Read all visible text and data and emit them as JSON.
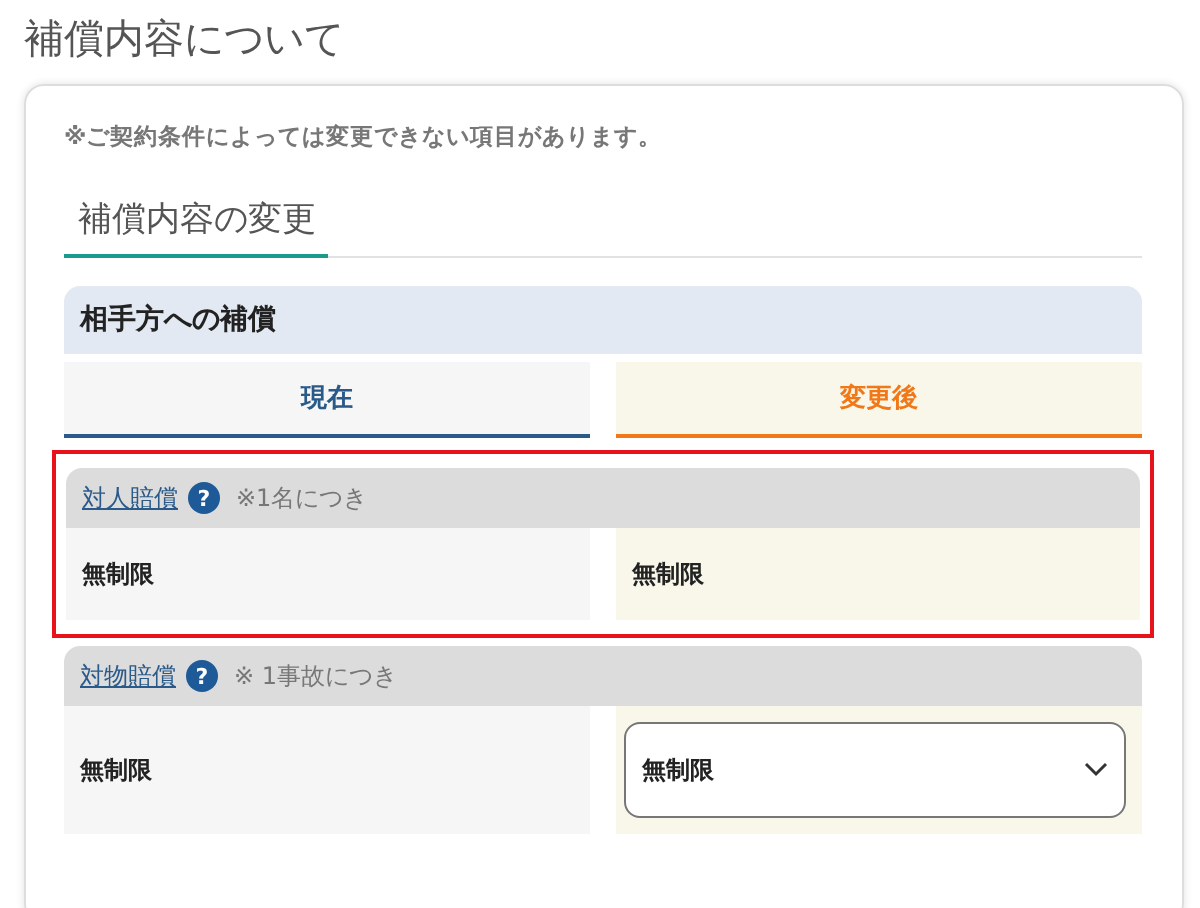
{
  "page_title": "補償内容について",
  "note": "※ご契約条件によっては変更できない項目があります。",
  "section_tab": {
    "label": "補償内容の変更"
  },
  "group": {
    "title": "相手方への補償",
    "columns": [
      {
        "label": "現在",
        "kind": "current"
      },
      {
        "label": "変更後",
        "kind": "changed"
      }
    ],
    "items": [
      {
        "label": "対人賠償",
        "help": "?",
        "condition": "※1名につき",
        "highlighted": true,
        "current": "無制限",
        "changed": {
          "kind": "text",
          "value": "無制限"
        }
      },
      {
        "label": "対物賠償",
        "help": "?",
        "condition": "※ 1事故につき",
        "highlighted": false,
        "current": "無制限",
        "changed": {
          "kind": "select",
          "value": "無制限"
        }
      }
    ]
  }
}
